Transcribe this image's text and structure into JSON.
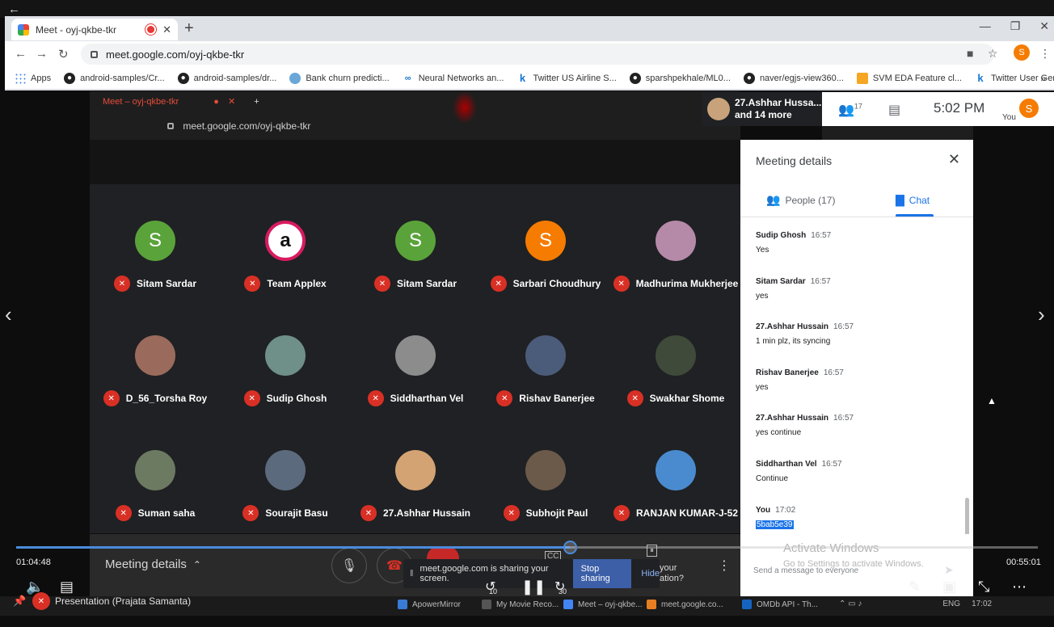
{
  "browser": {
    "tab_title": "Meet - oyj-qkbe-tkr",
    "url": "meet.google.com/oyj-qkbe-tkr",
    "profile_initial": "S",
    "bookmarks": [
      {
        "label": "Apps",
        "icon": "apps-icon"
      },
      {
        "label": "android-samples/Cr...",
        "icon": "github-icon"
      },
      {
        "label": "android-samples/dr...",
        "icon": "github-icon"
      },
      {
        "label": "Bank churn predicti...",
        "icon": "globe-icon"
      },
      {
        "label": "Neural Networks an...",
        "icon": "infinity-icon"
      },
      {
        "label": "Twitter US Airline S...",
        "icon": "kaggle-icon"
      },
      {
        "label": "sparshpekhale/ML0...",
        "icon": "github-icon"
      },
      {
        "label": "naver/egjs-view360...",
        "icon": "github-icon"
      },
      {
        "label": "SVM EDA Feature cl...",
        "icon": "book-icon"
      },
      {
        "label": "Twitter User Gender...",
        "icon": "kaggle-icon"
      }
    ],
    "more_bookmarks": "»"
  },
  "inner_browser": {
    "tab_title": "Meet – oyj-qkbe-tkr",
    "url": "meet.google.com/oyj-qkbe-tkr"
  },
  "header": {
    "presenter_line1": "27.Ashhar Hussa...",
    "presenter_line2": "and 14 more",
    "people_count": "17",
    "time": "5:02 PM",
    "you_label": "You",
    "avatar_initial": "S"
  },
  "participants": [
    {
      "name": "Sitam Sardar",
      "initial": "S",
      "color": "#5aa33b"
    },
    {
      "name": "Team Applex",
      "initial": "a",
      "color": "#ffffff"
    },
    {
      "name": "Sitam Sardar",
      "initial": "S",
      "color": "#5aa33b"
    },
    {
      "name": "Sarbari Choudhury",
      "initial": "S",
      "color": "#f57c00"
    },
    {
      "name": "Madhurima Mukherjee",
      "initial": "",
      "color": "#b58aa8"
    },
    {
      "name": "D_56_Torsha Roy",
      "initial": "",
      "color": "#9a6b5c"
    },
    {
      "name": "Sudip Ghosh",
      "initial": "",
      "color": "#6f8f89"
    },
    {
      "name": "Siddharthan Vel",
      "initial": "",
      "color": "#8c8c8c"
    },
    {
      "name": "Rishav Banerjee",
      "initial": "",
      "color": "#4b5c7a"
    },
    {
      "name": "Swakhar Shome",
      "initial": "",
      "color": "#3f4a3a"
    },
    {
      "name": "Suman saha",
      "initial": "",
      "color": "#6c7a62"
    },
    {
      "name": "Sourajit Basu",
      "initial": "",
      "color": "#5b6a7d"
    },
    {
      "name": "27.Ashhar Hussain",
      "initial": "",
      "color": "#d4a373"
    },
    {
      "name": "Subhojit Paul",
      "initial": "",
      "color": "#6b5a4a"
    },
    {
      "name": "RANJAN KUMAR-J-52",
      "initial": "",
      "color": "#4a8bd0"
    }
  ],
  "panel": {
    "title": "Meeting details",
    "people_tab": "People (17)",
    "chat_tab": "Chat",
    "messages": [
      {
        "sender": "Sudip Ghosh",
        "time": "16:57",
        "text": "Yes"
      },
      {
        "sender": "Sitam Sardar",
        "time": "16:57",
        "text": "yes"
      },
      {
        "sender": "27.Ashhar Hussain",
        "time": "16:57",
        "text": "1 min plz, its syncing"
      },
      {
        "sender": "Rishav Banerjee",
        "time": "16:57",
        "text": "yes"
      },
      {
        "sender": "27.Ashhar Hussain",
        "time": "16:57",
        "text": "yes continue"
      },
      {
        "sender": "Siddharthan Vel",
        "time": "16:57",
        "text": "Continue"
      },
      {
        "sender": "You",
        "time": "17:02",
        "text": "5bab5e39"
      }
    ],
    "send_placeholder": "Send a message to everyone",
    "activate_title": "Activate Windows",
    "activate_sub": "Go to Settings to activate Windows."
  },
  "controls": {
    "meeting_details": "Meeting details",
    "sharing_text": "meet.google.com is sharing your screen.",
    "stop_sharing": "Stop sharing",
    "hide": "Hide",
    "your_text_1": "your",
    "your_text_2": "ation?"
  },
  "taskbar": {
    "presenter_label": "Presentation (Prajata Samanta)",
    "items": [
      "ApowerMirror",
      "My Movie Reco...",
      "Meet – oyj-qkbe...",
      "meet.google.co...",
      "OMDb API - Th..."
    ],
    "lang": "ENG",
    "clock": "17:02"
  },
  "player": {
    "elapsed": "01:04:48",
    "remaining": "00:55:01",
    "progress_fraction": 0.542,
    "skip_back": "10",
    "skip_forward": "30"
  }
}
